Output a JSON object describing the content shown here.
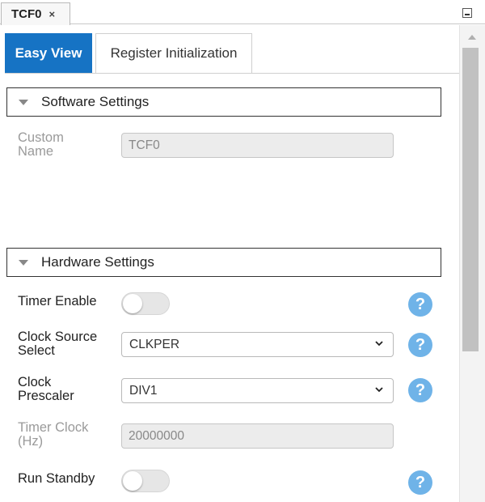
{
  "doc_tab": {
    "title": "TCF0",
    "close_glyph": "×"
  },
  "view_tabs": [
    {
      "label": "Easy View",
      "active": true
    },
    {
      "label": "Register Initialization",
      "active": false
    }
  ],
  "software_section": {
    "title": "Software Settings",
    "custom_name": {
      "label_line1": "Custom",
      "label_line2": "Name",
      "value": "TCF0"
    }
  },
  "hardware_section": {
    "title": "Hardware Settings",
    "timer_enable": {
      "label": "Timer Enable",
      "on": false
    },
    "clock_source": {
      "label_line1": "Clock Source",
      "label_line2": "Select",
      "value": "CLKPER"
    },
    "clock_prescaler": {
      "label_line1": "Clock",
      "label_line2": "Prescaler",
      "value": "DIV1"
    },
    "timer_clock": {
      "label_line1": "Timer Clock",
      "label_line2": "(Hz)",
      "value": "20000000"
    },
    "run_standby": {
      "label": "Run Standby",
      "on": false
    }
  },
  "help_glyph": "?",
  "colors": {
    "accent": "#1673c4",
    "help": "#6fb3e8"
  }
}
